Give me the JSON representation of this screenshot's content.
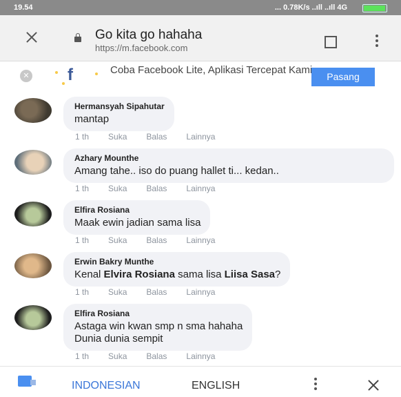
{
  "status": {
    "time": "19.54",
    "network": "... 0.78K/s ..ıll ..ıll 4G"
  },
  "browser": {
    "title": "Go kita go hahaha",
    "url": "https://m.facebook.com"
  },
  "promo": {
    "close_glyph": "✕",
    "logo": "f",
    "text": "Coba Facebook Lite, Aplikasi Tercepat Kami",
    "install_label": "Pasang"
  },
  "comments": [
    {
      "name": "Hermansyah Sipahutar",
      "text": "mantap",
      "time": "1 th",
      "like": "Suka",
      "reply": "Balas",
      "more": "Lainnya"
    },
    {
      "name": "Azhary Mounthe",
      "text": "Amang tahe.. iso do puang hallet ti... kedan..",
      "time": "1 th",
      "like": "Suka",
      "reply": "Balas",
      "more": "Lainnya"
    },
    {
      "name": "Elfira Rosiana",
      "text": "Maak ewin jadian sama lisa",
      "time": "1 th",
      "like": "Suka",
      "reply": "Balas",
      "more": "Lainnya"
    },
    {
      "name": "Erwin Bakry Munthe",
      "text_parts": [
        "Kenal ",
        "Elvira Rosiana",
        " sama lisa ",
        "Liisa Sasa",
        "?"
      ],
      "time": "1 th",
      "like": "Suka",
      "reply": "Balas",
      "more": "Lainnya"
    },
    {
      "name": "Elfira Rosiana",
      "text": "Astaga win kwan smp n sma hahaha\nDunia dunia sempit",
      "time": "1 th",
      "like": "Suka",
      "reply": "Balas",
      "more": "Lainnya"
    }
  ],
  "translate": {
    "source_lang": "INDONESIAN",
    "target_lang": "ENGLISH"
  },
  "colors": {
    "accent": "#4a8ff0",
    "facebook": "#3b5998",
    "bubble": "#f1f2f6"
  }
}
